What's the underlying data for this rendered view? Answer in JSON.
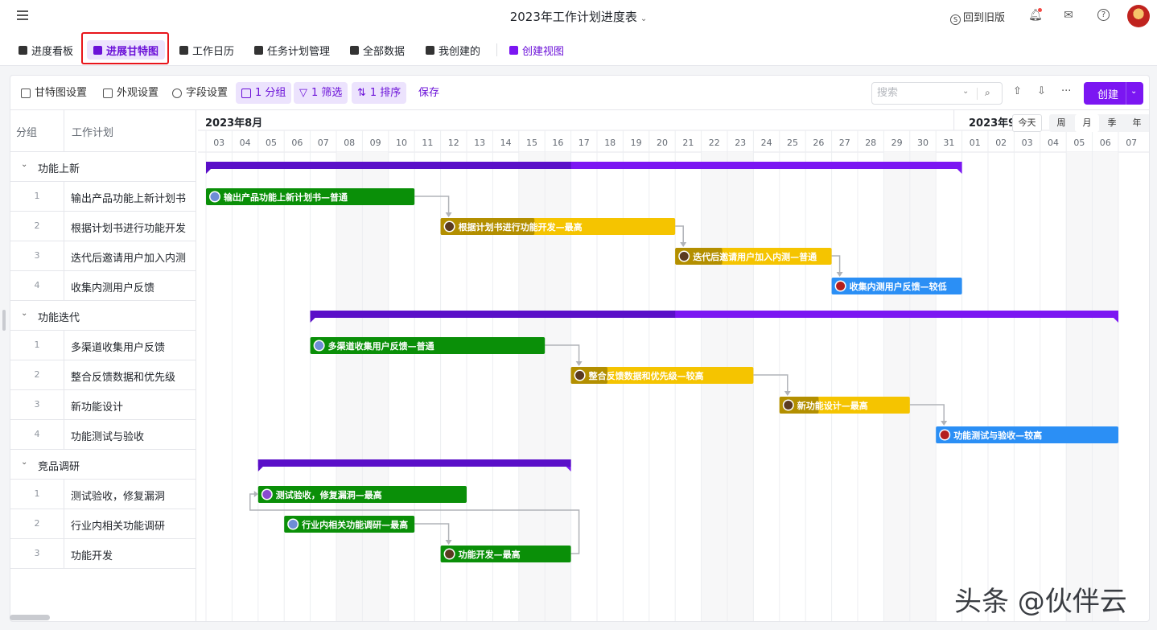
{
  "topbar": {
    "title": "2023年工作计划进度表",
    "old_version": "回到旧版",
    "icons": [
      "menu-icon",
      "bell-icon",
      "inbox-icon",
      "help-icon"
    ]
  },
  "views": {
    "tabs": [
      {
        "label": "进度看板",
        "icon": "board-icon"
      },
      {
        "label": "进展甘特图",
        "icon": "gantt-icon",
        "active": true
      },
      {
        "label": "工作日历",
        "icon": "calendar-icon"
      },
      {
        "label": "任务计划管理",
        "icon": "grid-icon"
      },
      {
        "label": "全部数据",
        "icon": "grid-icon"
      },
      {
        "label": "我创建的",
        "icon": "grid-icon"
      }
    ],
    "create_view": "创建视图"
  },
  "toolbar": {
    "gantt_settings": "甘特图设置",
    "appearance": "外观设置",
    "fields": "字段设置",
    "group": "1 分组",
    "filter": "1 筛选",
    "sort": "1 排序",
    "save": "保存",
    "search_placeholder": "搜索",
    "create": "创建"
  },
  "table": {
    "col_group": "分组",
    "col_plan": "工作计划",
    "groups": [
      {
        "name": "功能上新",
        "tasks": [
          {
            "no": "1",
            "name": "输出产品功能上新计划书"
          },
          {
            "no": "2",
            "name": "根据计划书进行功能开发"
          },
          {
            "no": "3",
            "name": "迭代后邀请用户加入内测"
          },
          {
            "no": "4",
            "name": "收集内测用户反馈"
          }
        ]
      },
      {
        "name": "功能迭代",
        "tasks": [
          {
            "no": "1",
            "name": "多渠道收集用户反馈"
          },
          {
            "no": "2",
            "name": "整合反馈数据和优先级"
          },
          {
            "no": "3",
            "name": "新功能设计"
          },
          {
            "no": "4",
            "name": "功能测试与验收"
          }
        ]
      },
      {
        "name": "竞品调研",
        "tasks": [
          {
            "no": "1",
            "name": "测试验收，修复漏洞"
          },
          {
            "no": "2",
            "name": "行业内相关功能调研"
          },
          {
            "no": "3",
            "name": "功能开发"
          }
        ]
      }
    ]
  },
  "timeline": {
    "month_aug": "2023年8月",
    "month_sep": "2023年9",
    "today": "今天",
    "scales": [
      "周",
      "月",
      "季",
      "年"
    ],
    "active_scale": "月",
    "days": [
      "03",
      "04",
      "05",
      "06",
      "07",
      "08",
      "09",
      "10",
      "11",
      "12",
      "13",
      "14",
      "15",
      "16",
      "17",
      "18",
      "19",
      "20",
      "21",
      "22",
      "23",
      "24",
      "25",
      "26",
      "27",
      "28",
      "29",
      "30",
      "31",
      "01",
      "02",
      "03",
      "04",
      "05",
      "06",
      "07"
    ],
    "weekend_days": [
      5,
      6,
      12,
      13,
      19,
      20,
      26,
      27,
      33,
      34
    ]
  },
  "colors": {
    "accent": "#7b16f2",
    "group_bar_dark": "#5a0fc8",
    "group_bar": "#7b16f2",
    "green": "#0a8f08",
    "yellow": "#f5c400",
    "yellow_dark": "#b38f00",
    "blue": "#2b8ff5",
    "dependency": "#b0b3b8"
  },
  "gantt": {
    "groups": [
      {
        "row": 0,
        "start": 0,
        "end": 29,
        "progress_end": 14
      },
      {
        "row": 5,
        "start": 4,
        "end": 35,
        "progress_end": 18
      },
      {
        "row": 10,
        "start": 2,
        "end": 14,
        "progress_end": 14
      }
    ],
    "bars": [
      {
        "row": 1,
        "start": 0,
        "end": 8,
        "label": "输出产品功能上新计划书—普通",
        "color": "green",
        "progress": 1.0,
        "avatar": "avatar-blue-icon"
      },
      {
        "row": 2,
        "start": 9,
        "end": 18,
        "label": "根据计划书进行功能开发—最高",
        "color": "yellow",
        "progress": 0.4,
        "avatar": "avatar-dark-icon"
      },
      {
        "row": 3,
        "start": 18,
        "end": 24,
        "label": "迭代后邀请用户加入内测—普通",
        "color": "yellow",
        "progress": 0.3,
        "avatar": "avatar-dark-icon"
      },
      {
        "row": 4,
        "start": 24,
        "end": 29,
        "label": "收集内测用户反馈—较低",
        "color": "blue",
        "progress": 0,
        "avatar": "avatar-red-icon"
      },
      {
        "row": 6,
        "start": 4,
        "end": 13,
        "label": "多渠道收集用户反馈—普通",
        "color": "green",
        "progress": 1.0,
        "avatar": "avatar-blue-icon"
      },
      {
        "row": 7,
        "start": 14,
        "end": 21,
        "label": "整合反馈数据和优先级—较高",
        "color": "yellow",
        "progress": 0.2,
        "avatar": "avatar-dark-icon"
      },
      {
        "row": 8,
        "start": 22,
        "end": 27,
        "label": "新功能设计—最高",
        "color": "yellow",
        "progress": 0.3,
        "avatar": "avatar-dark-icon"
      },
      {
        "row": 9,
        "start": 28,
        "end": 35,
        "label": "功能测试与验收—较高",
        "color": "blue",
        "progress": 0,
        "avatar": "avatar-red-icon"
      },
      {
        "row": 11,
        "start": 2,
        "end": 10,
        "label": "测试验收，修复漏洞—最高",
        "color": "green",
        "progress": 1.0,
        "avatar": "avatar-purple-icon"
      },
      {
        "row": 12,
        "start": 3,
        "end": 8,
        "label": "行业内相关功能调研—最高",
        "color": "green",
        "progress": 1.0,
        "avatar": "avatar-blue-icon"
      },
      {
        "row": 13,
        "start": 9,
        "end": 14,
        "label": "功能开发—最高",
        "color": "green",
        "progress": 1.0,
        "avatar": "avatar-dark-icon"
      }
    ],
    "dependencies": [
      [
        0,
        1
      ],
      [
        1,
        2
      ],
      [
        2,
        3
      ],
      [
        4,
        5
      ],
      [
        5,
        6
      ],
      [
        6,
        7
      ],
      [
        9,
        10
      ]
    ],
    "back_dependency": [
      10,
      8
    ]
  },
  "watermark": "头条 @伙伴云"
}
